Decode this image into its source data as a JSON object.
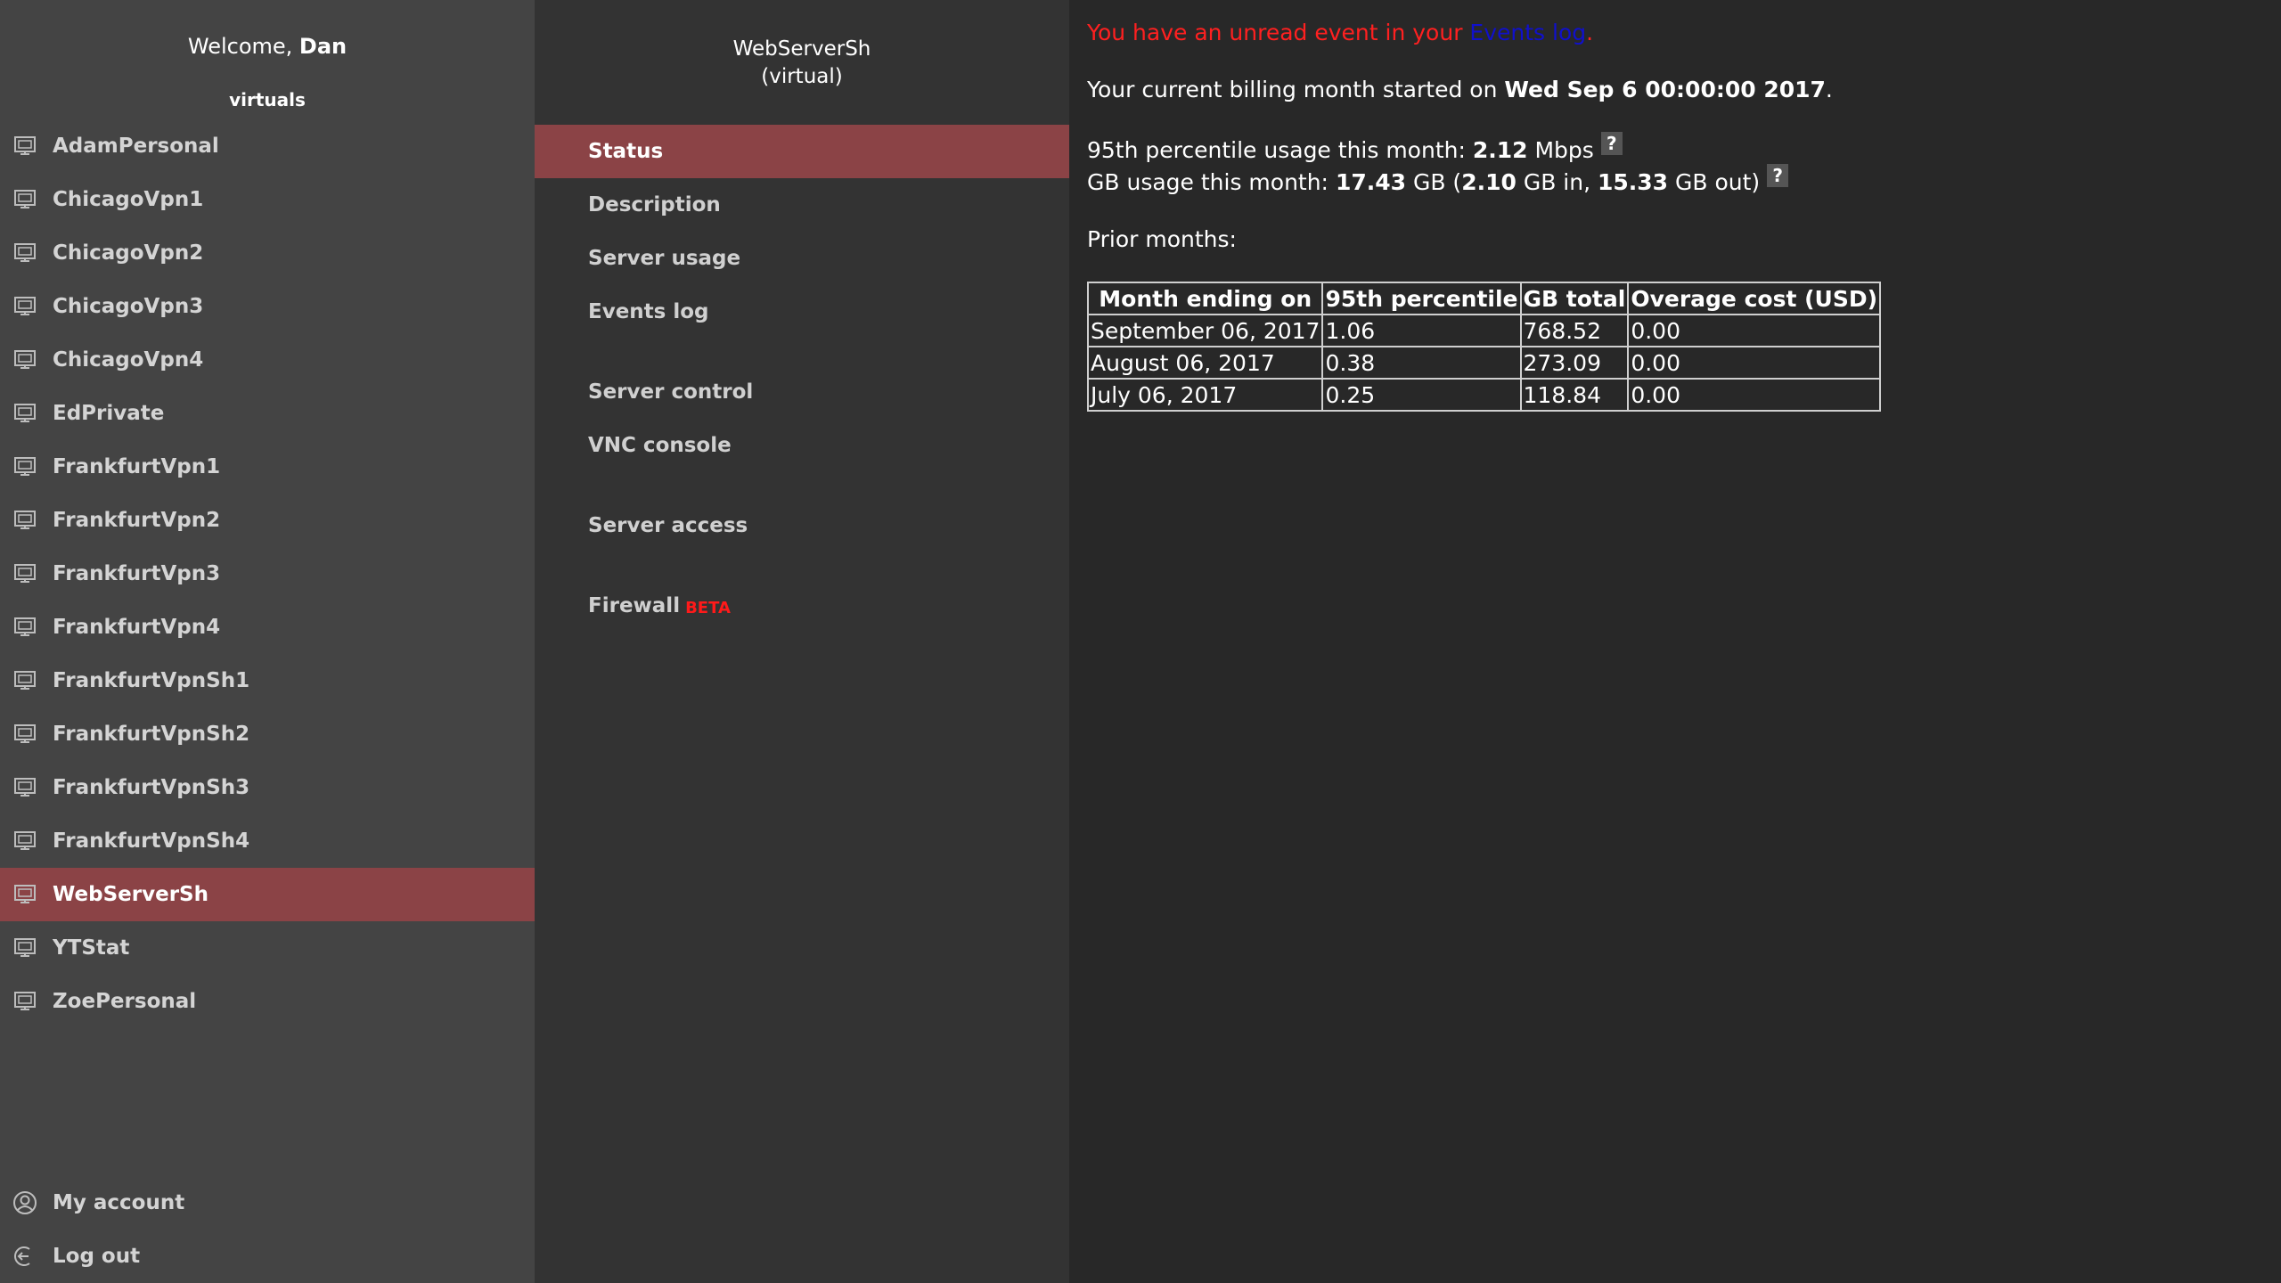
{
  "sidebar": {
    "welcome_prefix": "Welcome, ",
    "user_name": "Dan",
    "section_label": "virtuals",
    "servers": [
      {
        "label": "AdamPersonal"
      },
      {
        "label": "ChicagoVpn1"
      },
      {
        "label": "ChicagoVpn2"
      },
      {
        "label": "ChicagoVpn3"
      },
      {
        "label": "ChicagoVpn4"
      },
      {
        "label": "EdPrivate"
      },
      {
        "label": "FrankfurtVpn1"
      },
      {
        "label": "FrankfurtVpn2"
      },
      {
        "label": "FrankfurtVpn3"
      },
      {
        "label": "FrankfurtVpn4"
      },
      {
        "label": "FrankfurtVpnSh1"
      },
      {
        "label": "FrankfurtVpnSh2"
      },
      {
        "label": "FrankfurtVpnSh3"
      },
      {
        "label": "FrankfurtVpnSh4"
      },
      {
        "label": "WebServerSh",
        "active": true
      },
      {
        "label": "YTStat"
      },
      {
        "label": "ZoePersonal"
      }
    ],
    "my_account": "My account",
    "log_out": "Log out"
  },
  "server_panel": {
    "name": "WebServerSh",
    "type": "(virtual)",
    "menu": {
      "status": "Status",
      "description": "Description",
      "server_usage": "Server usage",
      "events_log": "Events log",
      "server_control": "Server control",
      "vnc_console": "VNC console",
      "server_access": "Server access",
      "firewall": "Firewall",
      "firewall_badge": "BETA"
    }
  },
  "content": {
    "unread_prefix": "You have an unread event in your ",
    "unread_link": "Events log",
    "unread_suffix": ".",
    "billing_prefix": "Your current billing month started on ",
    "billing_date": "Wed Sep 6 00:00:00 2017",
    "billing_suffix": ".",
    "p95_prefix": "95th percentile usage this month: ",
    "p95_value": "2.12",
    "p95_unit": " Mbps",
    "gb_prefix": "GB usage this month: ",
    "gb_total": "17.43",
    "gb_mid1": " GB (",
    "gb_in": "2.10",
    "gb_mid2": " GB in, ",
    "gb_out": "15.33",
    "gb_suffix": " GB out)",
    "help_label": "?",
    "prior_label": "Prior months:",
    "table": {
      "headers": [
        "Month ending on",
        "95th percentile",
        "GB total",
        "Overage cost (USD)"
      ],
      "rows": [
        [
          "September 06, 2017",
          "1.06",
          "768.52",
          "0.00"
        ],
        [
          "August 06, 2017",
          "0.38",
          "273.09",
          "0.00"
        ],
        [
          "July 06, 2017",
          "0.25",
          "118.84",
          "0.00"
        ]
      ]
    }
  },
  "colors": {
    "accent": "#8b4346",
    "alert": "#ff2020",
    "link": "#1010cc",
    "sidebar_bg": "#444444",
    "panel_bg": "#333333",
    "content_bg": "#282828"
  }
}
